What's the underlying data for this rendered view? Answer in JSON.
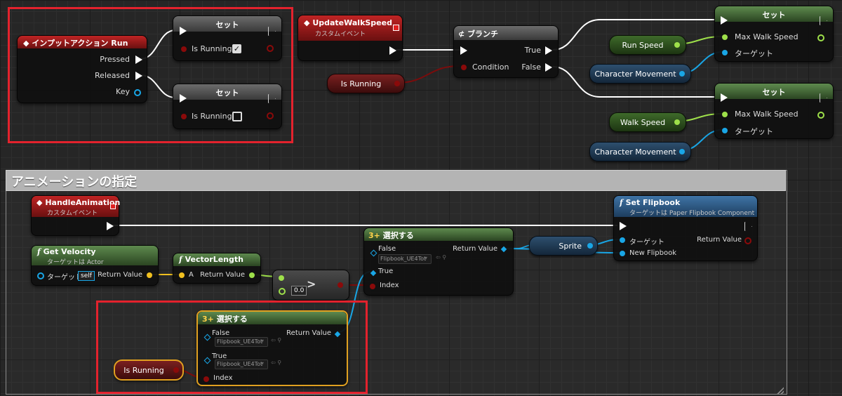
{
  "comment": {
    "title": "アニメーションの指定"
  },
  "input_action": {
    "title": "インプットアクション Run",
    "pins": {
      "pressed": "Pressed",
      "released": "Released",
      "key": "Key"
    }
  },
  "set_true": {
    "title": "セット",
    "pin": "Is Running",
    "checked": true
  },
  "set_false": {
    "title": "セット",
    "pin": "Is Running",
    "checked": false
  },
  "update_walk": {
    "title": "UpdateWalkSpeed",
    "subtitle": "カスタムイベント"
  },
  "isrunning_var_1": {
    "label": "Is Running"
  },
  "branch": {
    "title": "ブランチ",
    "condition": "Condition",
    "true_label": "True",
    "false_label": "False"
  },
  "set_speed_top": {
    "title": "セット",
    "pin1": "Max Walk Speed",
    "pin2": "ターゲット"
  },
  "set_speed_bottom": {
    "title": "セット",
    "pin1": "Max Walk Speed",
    "pin2": "ターゲット"
  },
  "run_speed": {
    "label": "Run Speed"
  },
  "walk_speed": {
    "label": "Walk Speed"
  },
  "char_move_1": {
    "label": "Character Movement"
  },
  "char_move_2": {
    "label": "Character Movement"
  },
  "handle_anim": {
    "title": "HandleAnimation",
    "subtitle": "カスタムイベント"
  },
  "get_velocity": {
    "title": "Get Velocity",
    "subtitle": "ターゲットは Actor",
    "target": "ターゲット",
    "self": "self",
    "ret": "Return Value"
  },
  "vector_length": {
    "title": "VectorLength",
    "a": "A",
    "ret": "Return Value"
  },
  "greater": {
    "op": ">",
    "value": "0.0"
  },
  "select_top": {
    "title": "選択する",
    "false_label": "False",
    "true_label": "True",
    "index": "Index",
    "ret": "Return Value",
    "false_value": "Flipbook_UE4Tot"
  },
  "select_bottom": {
    "title": "選択する",
    "false_label": "False",
    "true_label": "True",
    "index": "Index",
    "ret": "Return Value",
    "false_value": "Flipbook_UE4Tot",
    "true_value": "Flipbook_UE4Tot"
  },
  "isrunning_var_2": {
    "label": "Is Running"
  },
  "sprite_var": {
    "label": "Sprite"
  },
  "set_flipbook": {
    "title": "Set Flipbook",
    "subtitle": "ターゲットは Paper Flipbook Component",
    "target": "ターゲット",
    "new_flipbook": "New Flipbook",
    "ret": "Return Value"
  },
  "icons": {
    "event": "event-diamond-icon",
    "branch": "branch-icon",
    "function": "function-icon",
    "select": "select-icon",
    "exec": "exec-arrow-icon"
  },
  "colors": {
    "exec": "#ffffff",
    "bool": "#8a0a0a",
    "float": "#9ee04a",
    "object": "#19a6e6",
    "vector": "#f0c020",
    "highlight": "#e3222d"
  }
}
